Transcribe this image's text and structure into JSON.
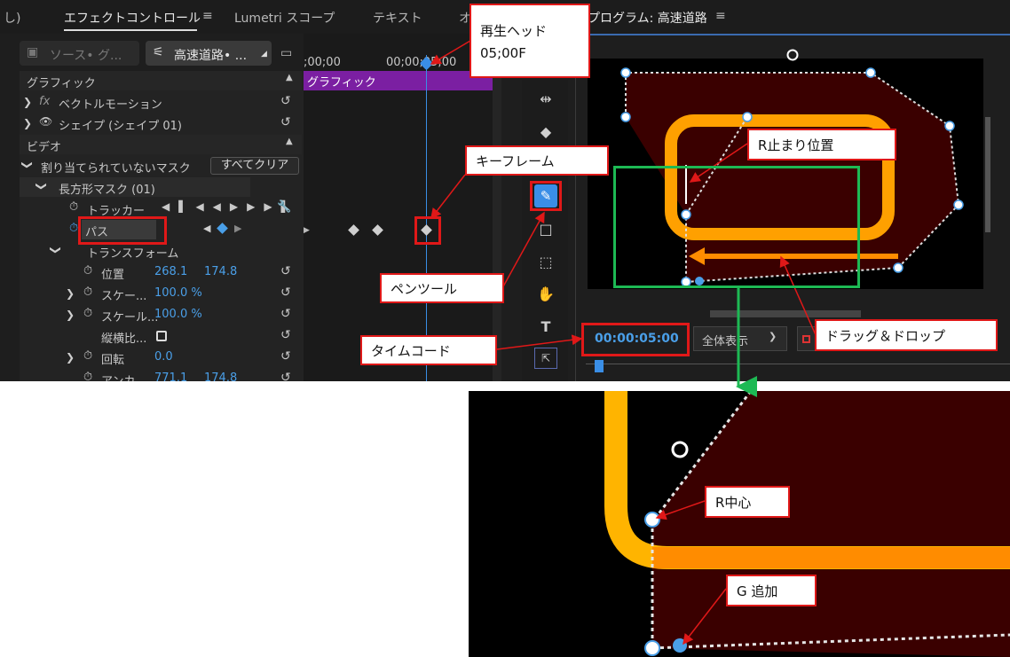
{
  "tabs": {
    "left_cut": "し)",
    "effect_controls": "エフェクトコントロール",
    "menu_glyph": "≡",
    "lumetri": "Lumetri スコープ",
    "text": "テキスト",
    "cut_o": "オ",
    "program": "プログラム: 高速道路",
    "program_menu": "≡"
  },
  "source": {
    "label": "ソース• グ...",
    "sequence": "高速道路• ..."
  },
  "timeline": {
    "t0": ";00;00",
    "t1": "00;00;05;00",
    "clip": "グラフィック"
  },
  "sections": {
    "graphic": "グラフィック",
    "vector_motion": "ベクトルモーション",
    "shape": "シェイプ (シェイプ 01)",
    "video": "ビデオ",
    "unassigned_mask": "割り当てられていないマスク",
    "clear_all": "すべてクリア",
    "rect_mask": "長方形マスク (01)",
    "tracker": "トラッカー",
    "path": "パス",
    "transform": "トランスフォーム"
  },
  "props": [
    {
      "name": "位置",
      "v1": "268.1",
      "v2": "174.8"
    },
    {
      "name": "スケー...",
      "v1": "100.0 %",
      "v2": ""
    },
    {
      "name": "スケール...",
      "v1": "100.0 %",
      "v2": ""
    },
    {
      "name": "縦横比...",
      "v1": "",
      "v2": ""
    },
    {
      "name": "回転",
      "v1": "0.0",
      "v2": ""
    },
    {
      "name": "アンカ...",
      "v1": "771.1",
      "v2": "174.8"
    }
  ],
  "program": {
    "timecode": "00:00:05:00",
    "fit": "全体表示"
  },
  "callouts": {
    "playhead": "再生ヘッド",
    "playhead_time": "05;00F",
    "keyframe": "キーフレーム",
    "r_stop": "R止まり位置",
    "pen_tool": "ペンツール",
    "timecode": "タイムコード",
    "drag_drop": "ドラッグ＆ドロップ",
    "r_center": "R中心",
    "g_add": "G 追加"
  },
  "colors": {
    "accent": "#3a8ee6",
    "callout_border": "#e01818",
    "highlight_box": "#1db954",
    "shape_fill": "#3a0000",
    "stroke_yellow": "#ffb400"
  }
}
